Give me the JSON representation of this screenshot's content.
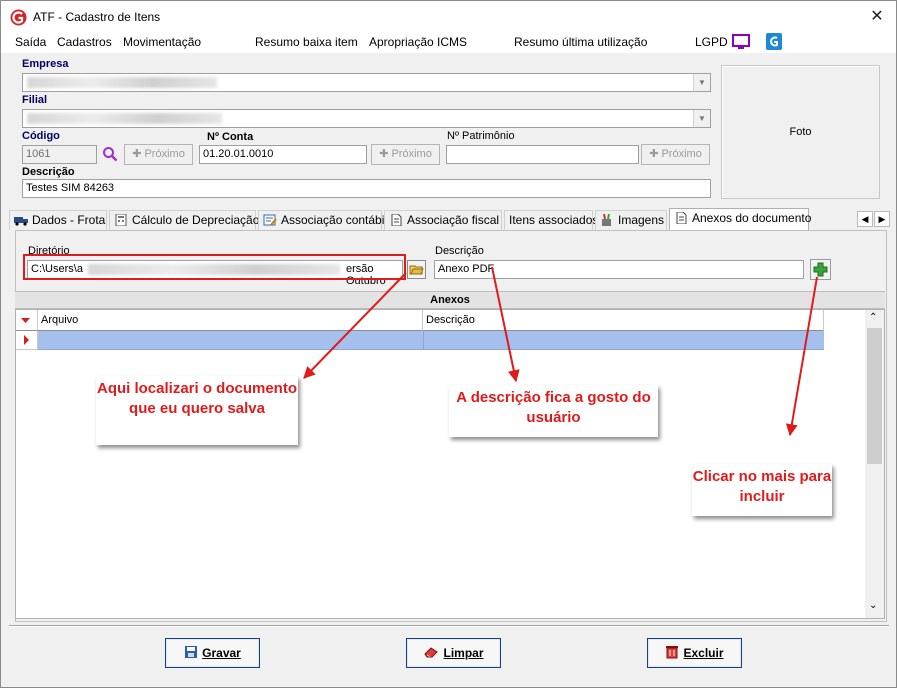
{
  "window": {
    "title": "ATF - Cadastro de Itens",
    "close_icon": "close-icon"
  },
  "menu": [
    "Saída",
    "Cadastros",
    "Movimentação",
    "Resumo baixa item",
    "Apropriação ICMS",
    "Resumo última utilização",
    "LGPD"
  ],
  "form": {
    "empresa_label": "Empresa",
    "filial_label": "Filial",
    "codigo_label": "Código",
    "codigo_value": "1061",
    "conta_label": "Nº Conta",
    "conta_value": "01.20.01.0010",
    "patrimonio_label": "Nº Patrimônio",
    "patrimonio_value": "",
    "proximo_label": "Próximo",
    "descricao_label": "Descrição",
    "descricao_value": "Testes SIM 84263",
    "foto_label": "Foto"
  },
  "tabs": [
    {
      "label": "Dados - Frota",
      "icon": "truck-icon"
    },
    {
      "label": "Cálculo de Depreciação",
      "icon": "calculator-icon"
    },
    {
      "label": "Associação contábil",
      "icon": "edit-form-icon"
    },
    {
      "label": "Associação fiscal",
      "icon": "document-icon"
    },
    {
      "label": "Itens associados",
      "icon": ""
    },
    {
      "label": "Imagens",
      "icon": "paint-icon"
    },
    {
      "label": "Anexos do documento",
      "icon": "document-icon",
      "active": true
    }
  ],
  "anexos": {
    "diretorio_label": "Diretório",
    "diretorio_start": "C:\\Users\\a",
    "diretorio_end": "ersão Outubro",
    "descricao_label": "Descrição",
    "descricao_value": "Anexo PDF",
    "section_title": "Anexos",
    "columns": [
      "Arquivo",
      "Descrição"
    ]
  },
  "buttons": {
    "gravar": "Gravar",
    "limpar": "Limpar",
    "excluir": "Excluir"
  },
  "annotations": {
    "note1": "Aqui localizari o documento que eu quero salva",
    "note2": "A descrição fica a gosto do usuário",
    "note3": "Clicar no mais para incluir"
  },
  "colors": {
    "annotation": "#e01b1b",
    "selection": "#a6c0ee",
    "label_blue": "#000066"
  }
}
